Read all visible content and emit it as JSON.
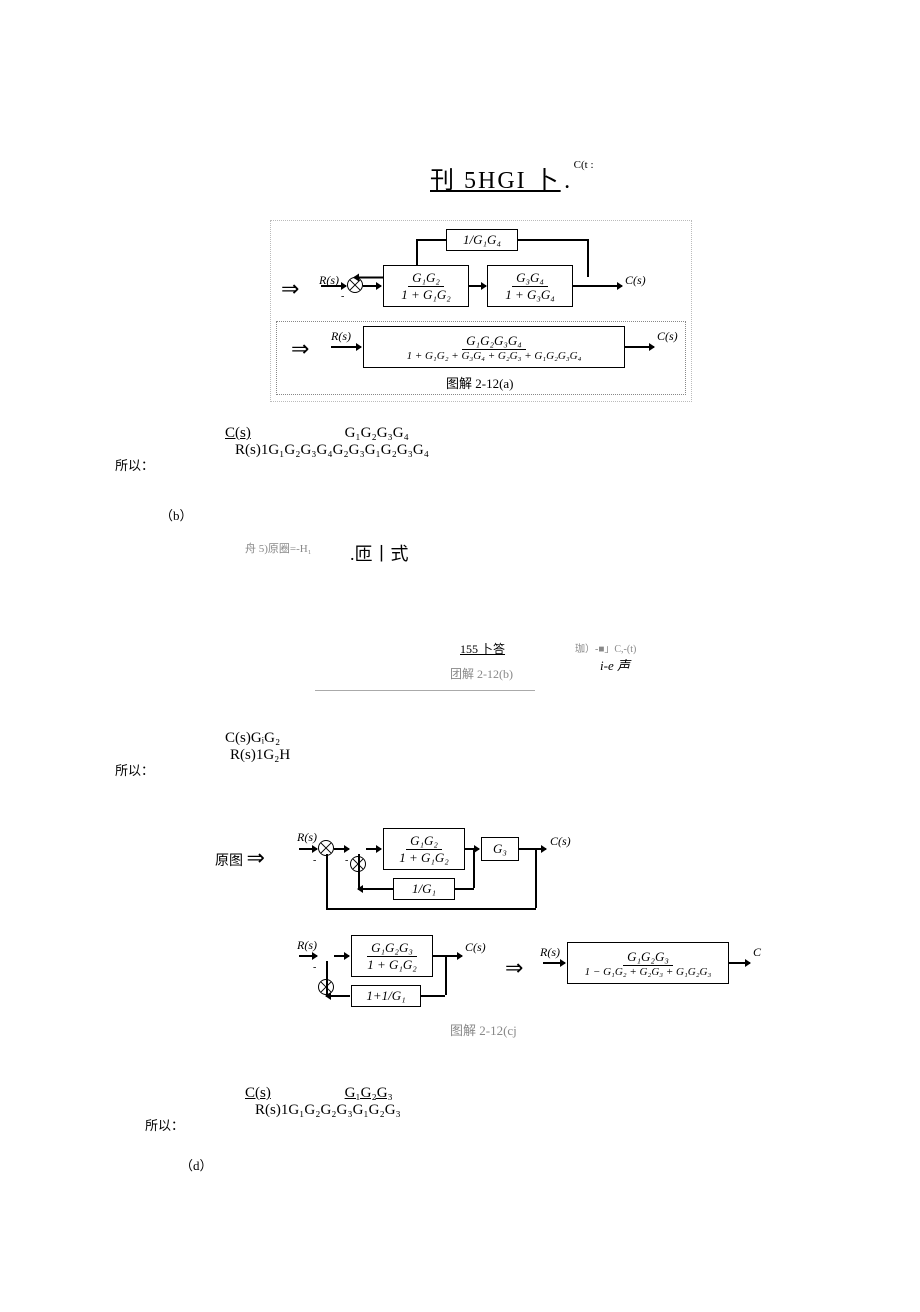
{
  "header": {
    "title": "刊 5HGI 卜",
    "sup": "C(t :",
    "dot": "."
  },
  "diagram_a": {
    "arrow": "⇒",
    "input": "R(s)",
    "output": "C(s)",
    "minus": "-",
    "fb_box": "1/G₁G₄",
    "box1_top": "G₁G₂",
    "box1_bot": "1 + G₁G₂",
    "box2_top": "G₃G₄",
    "box2_bot": "1 + G₃G₄",
    "step2_input": "R(s)",
    "step2_output": "C(s)",
    "step2_top": "G₁G₂G₃G₄",
    "step2_bot": "1 + G₁G₂ + G₃G₄ + G₂G₃ + G₁G₂G₃G₄",
    "caption": "图解 2-12(a)"
  },
  "result_a": {
    "label": "所以：",
    "cs": "C(s)",
    "num": "G₁G₂G₃G₄",
    "den": "R(s)1G₁G₂G₃G₄G₂G₃G₁G₂G₃G₄"
  },
  "section_b": {
    "marker": "（b）",
    "note1": "舟 5)原圈=-H₁",
    "note2": ".匝丨式",
    "line1": "155 卜答",
    "line2": "珈）-■」C,-(t)",
    "line3": "i-e 声",
    "caption": "团解 2-12(b)"
  },
  "result_b": {
    "label": "所以：",
    "num": "C(s)GᵢG₂",
    "den": "R(s)1G₂H"
  },
  "diagram_c": {
    "yuantu": "原图",
    "arrow": "⇒",
    "input": "R(s)",
    "output": "C(s)",
    "minus": "-",
    "step1_box1_top": "G₁G₂",
    "step1_box1_bot": "1 + G₁G₂",
    "step1_box2": "G₃",
    "step1_fb": "1/G₁",
    "step2_input": "R(s)",
    "step2_output": "C(s)",
    "step2_box1_top": "G₁G₂G₃",
    "step2_box1_bot": "1 + G₁G₂",
    "step2_fb": "1+1/G₁",
    "step3_input": "R(s)",
    "step3_output": "C",
    "step3_top": "G₁G₂G₃",
    "step3_bot": "1 − G₁G₂ + G₂G₃ + G₁G₂G₃",
    "caption": "图解 2-12(cj"
  },
  "result_c": {
    "label": "所以：",
    "cs": "C(s)",
    "num": "G₁G₂G₃",
    "den": "R(s)1G₁G₂G₂G₃G₁G₂G₃"
  },
  "section_d": {
    "marker": "（d）"
  }
}
